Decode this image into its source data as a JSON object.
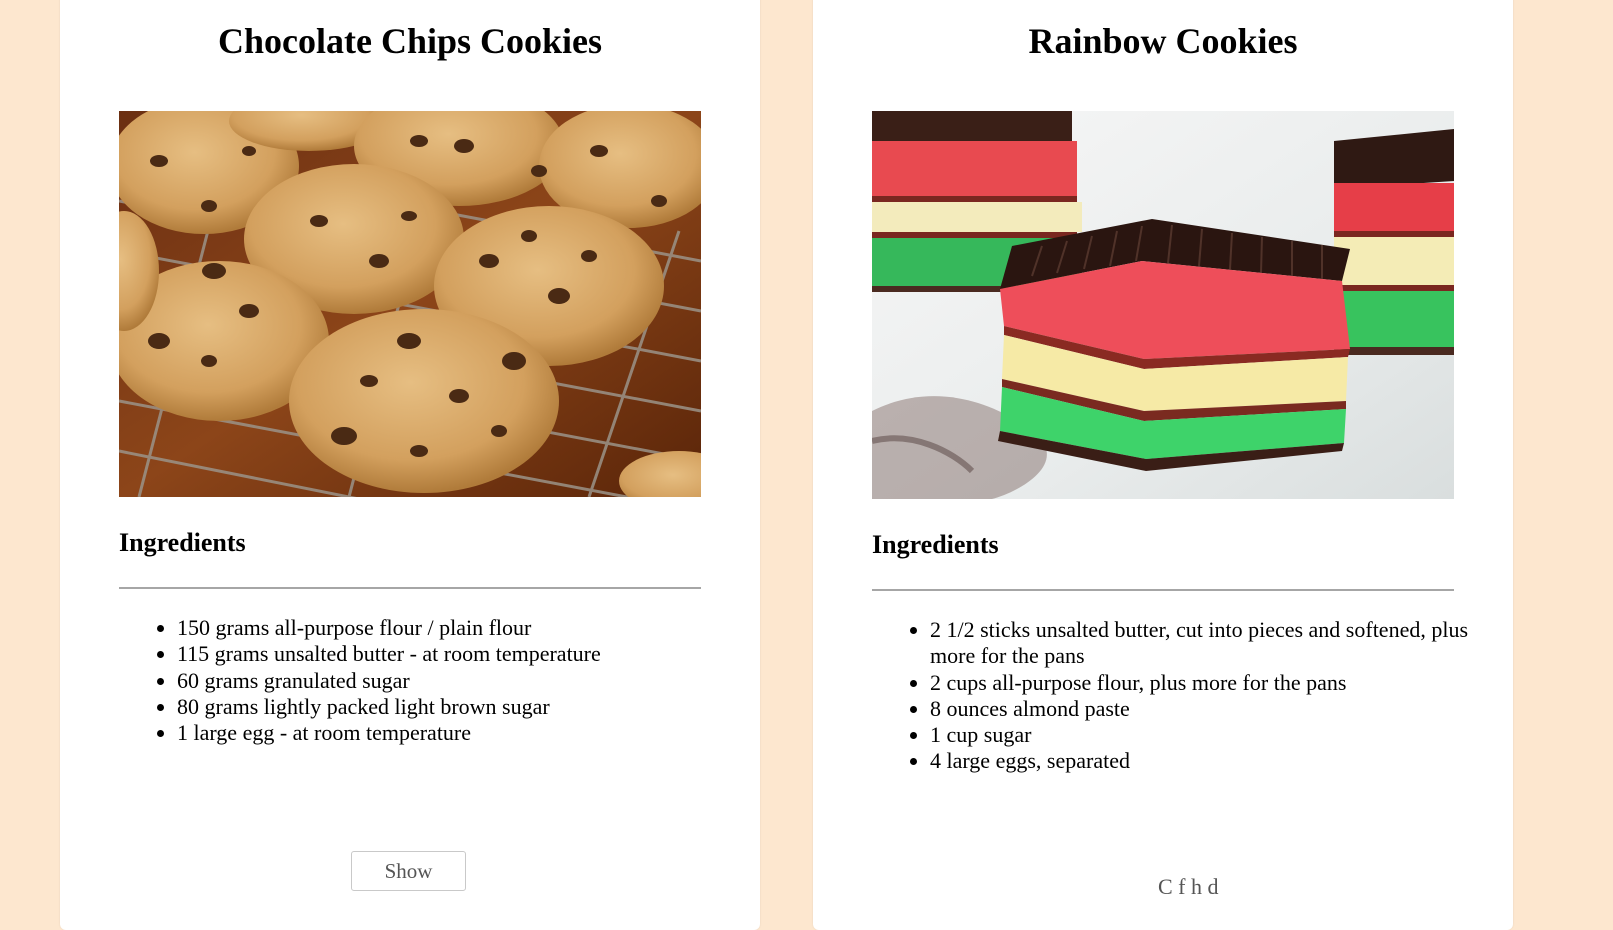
{
  "colors": {
    "page_background": "#fde7cf",
    "card_background": "#ffffff",
    "rule": "#a6a6a6"
  },
  "recipes": [
    {
      "title": "Chocolate Chips Cookies",
      "ingredients_heading": "Ingredients",
      "ingredients": [
        "150 grams all-purpose flour / plain flour",
        "115 grams unsalted butter - at room temperature",
        "60 grams granulated sugar",
        "80 grams lightly packed light brown sugar",
        "1 large egg - at room temperature"
      ],
      "show_label": "Show"
    },
    {
      "title": "Rainbow Cookies",
      "ingredients_heading": "Ingredients",
      "ingredients": [
        "2 1/2 sticks unsalted butter, cut into pieces and softened, plus more for the pans",
        "2 cups all-purpose flour, plus more for the pans",
        "8 ounces almond paste",
        "1 cup sugar",
        "4 large eggs, separated"
      ],
      "trailing_text": "C          f   h        d"
    }
  ]
}
